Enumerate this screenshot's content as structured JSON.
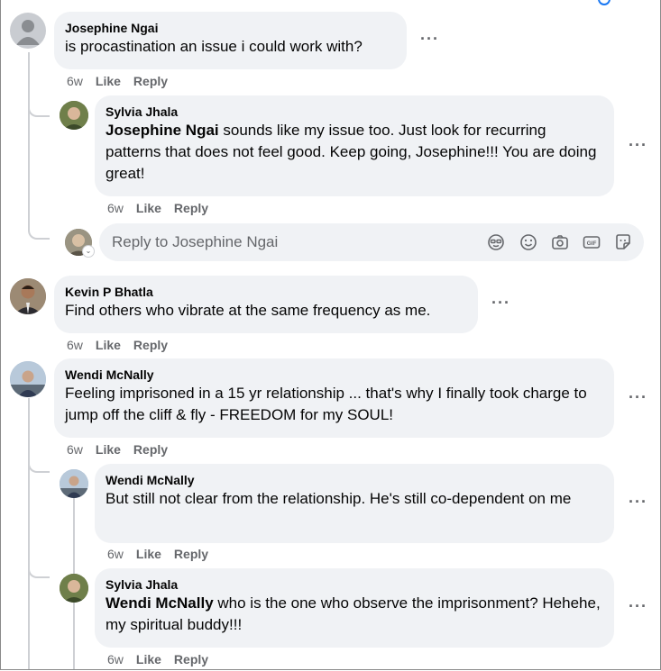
{
  "comments": [
    {
      "author": "Josephine Ngai",
      "text": "is procastination an issue i could work with?",
      "time": "6w",
      "like": "Like",
      "reply": "Reply"
    },
    {
      "author": "Sylvia Jhala",
      "mention": "Josephine Ngai",
      "text": " sounds like my issue too. Just look for recurring patterns that does not feel good. Keep going, Josephine!!! You are doing great!",
      "time": "6w",
      "like": "Like",
      "reply": "Reply"
    },
    {
      "author": "Kevin P Bhatla",
      "text": "Find others who vibrate at the same frequency as me.",
      "time": "6w",
      "like": "Like",
      "reply": "Reply"
    },
    {
      "author": "Wendi McNally",
      "text": "Feeling imprisoned in a 15 yr relationship ... that's why I finally took charge to jump off the cliff & fly - FREEDOM for my SOUL!",
      "time": "6w",
      "like": "Like",
      "reply": "Reply"
    },
    {
      "author": "Wendi McNally",
      "text": "But still not clear from the relationship. He's still co-dependent on me",
      "time": "6w",
      "like": "Like",
      "reply": "Reply"
    },
    {
      "author": "Sylvia Jhala",
      "mention": "Wendi McNally",
      "text": " who is the one who observe the imprisonment? Hehehe, my spiritual buddy!!!",
      "time": "6w",
      "like": "Like",
      "reply": "Reply"
    }
  ],
  "reply_box": {
    "placeholder": "Reply to Josephine Ngai",
    "icons": [
      "avatar-sticker-icon",
      "emoji-icon",
      "camera-icon",
      "gif-icon",
      "sticker-icon"
    ]
  },
  "more_icon": "more-options-icon",
  "colors": {
    "bubble": "#f0f2f5",
    "meta_text": "#65676b",
    "thread_line": "#ced0d4",
    "accent": "#1877f2"
  }
}
